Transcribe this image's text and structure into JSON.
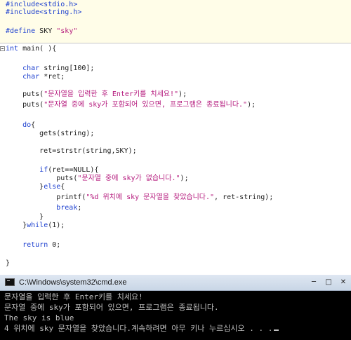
{
  "editor": {
    "lines": [
      {
        "parts": [
          {
            "t": "#include<stdio.h>",
            "c": "kw"
          }
        ]
      },
      {
        "parts": [
          {
            "t": "#include<string.h>",
            "c": "kw"
          }
        ]
      },
      {
        "parts": [
          {
            "t": "",
            "c": "txt"
          }
        ]
      },
      {
        "parts": [
          {
            "t": "#define",
            "c": "kw"
          },
          {
            "t": " SKY ",
            "c": "txt"
          },
          {
            "t": "\"sky\"",
            "c": "str"
          }
        ]
      },
      {
        "parts": [
          {
            "t": "int",
            "c": "kw"
          },
          {
            "t": " main( ){",
            "c": "txt"
          }
        ]
      },
      {
        "parts": [
          {
            "t": "",
            "c": "txt"
          }
        ]
      },
      {
        "parts": [
          {
            "t": "    ",
            "c": "txt"
          },
          {
            "t": "char",
            "c": "kw"
          },
          {
            "t": " string[100];",
            "c": "txt"
          }
        ]
      },
      {
        "parts": [
          {
            "t": "    ",
            "c": "txt"
          },
          {
            "t": "char",
            "c": "kw"
          },
          {
            "t": " *ret;",
            "c": "txt"
          }
        ]
      },
      {
        "parts": [
          {
            "t": "",
            "c": "txt"
          }
        ]
      },
      {
        "parts": [
          {
            "t": "    puts(",
            "c": "txt"
          },
          {
            "t": "\"문자열을 입력한 후 Enter키를 치세요!\"",
            "c": "str"
          },
          {
            "t": ");",
            "c": "txt"
          }
        ]
      },
      {
        "parts": [
          {
            "t": "    puts(",
            "c": "txt"
          },
          {
            "t": "\"문자열 중에 sky가 포함되어 있으면, 프로그램은 종료됩니다.\"",
            "c": "str"
          },
          {
            "t": ");",
            "c": "txt"
          }
        ]
      },
      {
        "parts": [
          {
            "t": "",
            "c": "txt"
          }
        ]
      },
      {
        "parts": [
          {
            "t": "    ",
            "c": "txt"
          },
          {
            "t": "do",
            "c": "kw"
          },
          {
            "t": "{",
            "c": "txt"
          }
        ]
      },
      {
        "parts": [
          {
            "t": "        gets(string);",
            "c": "txt"
          }
        ]
      },
      {
        "parts": [
          {
            "t": "",
            "c": "txt"
          }
        ]
      },
      {
        "parts": [
          {
            "t": "        ret=strstr(string,SKY);",
            "c": "txt"
          }
        ]
      },
      {
        "parts": [
          {
            "t": "",
            "c": "txt"
          }
        ]
      },
      {
        "parts": [
          {
            "t": "        ",
            "c": "txt"
          },
          {
            "t": "if",
            "c": "kw"
          },
          {
            "t": "(ret==NULL){",
            "c": "txt"
          }
        ]
      },
      {
        "parts": [
          {
            "t": "            puts(",
            "c": "txt"
          },
          {
            "t": "\"문자열 중에 sky가 없습니다.\"",
            "c": "str"
          },
          {
            "t": ");",
            "c": "txt"
          }
        ]
      },
      {
        "parts": [
          {
            "t": "        }",
            "c": "txt"
          },
          {
            "t": "else",
            "c": "kw"
          },
          {
            "t": "{",
            "c": "txt"
          }
        ]
      },
      {
        "parts": [
          {
            "t": "            printf(",
            "c": "txt"
          },
          {
            "t": "\"%d 위치에 sky 문자열을 찾았습니다.\"",
            "c": "str"
          },
          {
            "t": ", ret-string);",
            "c": "txt"
          }
        ]
      },
      {
        "parts": [
          {
            "t": "            ",
            "c": "txt"
          },
          {
            "t": "break",
            "c": "kw"
          },
          {
            "t": ";",
            "c": "txt"
          }
        ]
      },
      {
        "parts": [
          {
            "t": "        }",
            "c": "txt"
          }
        ]
      },
      {
        "parts": [
          {
            "t": "    }",
            "c": "txt"
          },
          {
            "t": "while",
            "c": "kw"
          },
          {
            "t": "(1);",
            "c": "txt"
          }
        ]
      },
      {
        "parts": [
          {
            "t": "",
            "c": "txt"
          }
        ]
      },
      {
        "parts": [
          {
            "t": "    ",
            "c": "txt"
          },
          {
            "t": "return",
            "c": "kw"
          },
          {
            "t": " 0;",
            "c": "txt"
          }
        ]
      },
      {
        "parts": [
          {
            "t": "",
            "c": "txt"
          }
        ]
      },
      {
        "parts": [
          {
            "t": "}",
            "c": "txt"
          }
        ]
      }
    ]
  },
  "cmd": {
    "title": "C:\\Windows\\system32\\cmd.exe",
    "minimize_label": "─",
    "maximize_label": "□",
    "close_label": "✕",
    "output": [
      "문자열을 입력한 후 Enter키를 치세요!",
      "문자열 중에 sky가 포함되어 있으면, 프로그램은 종료됩니다.",
      "The sky is blue",
      "4 위치에 sky 문자열을 찾았습니다.계속하려면 아무 키나 누르십시오 . . ."
    ]
  }
}
